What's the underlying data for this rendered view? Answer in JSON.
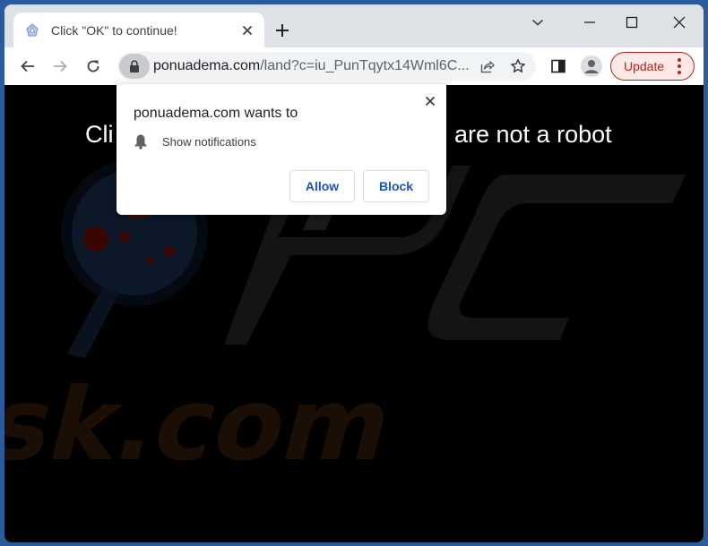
{
  "browser": {
    "tab": {
      "title": "Click \"OK\" to continue!",
      "favicon": "bell-notification-icon"
    },
    "window_controls": [
      "chevron-down-icon",
      "minimize-icon",
      "maximize-icon",
      "close-icon"
    ],
    "address_bar": {
      "host": "ponuadema.com",
      "path": "/land?c=iu_PunTqytx14Wml6C...",
      "security_icon": "lock-icon"
    },
    "toolbar": {
      "update_label": "Update"
    },
    "colors": {
      "accent_update": "#b3261e",
      "popup_button_text": "#1a55b5",
      "frame": "#2a5b9c"
    }
  },
  "page": {
    "headline_left": "Cli",
    "headline_right": "are not a robot",
    "watermark_text": "PC risk.com"
  },
  "permission_popup": {
    "title": "ponuadema.com wants to",
    "permission_label": "Show notifications",
    "permission_icon": "bell-icon",
    "allow_label": "Allow",
    "block_label": "Block"
  }
}
